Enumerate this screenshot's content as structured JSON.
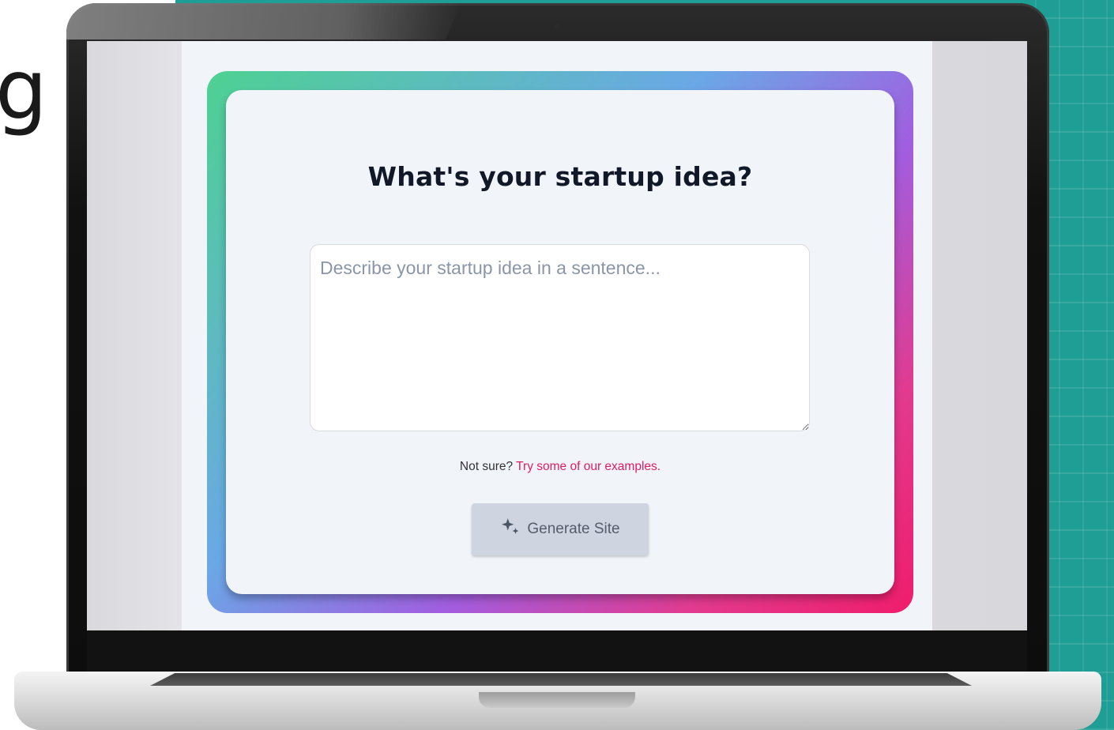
{
  "background": {
    "partial_glyph": "g",
    "accent_color": "#1f9e96"
  },
  "app": {
    "title": "What's your startup idea?",
    "idea_input": {
      "placeholder": "Describe your startup idea in a sentence...",
      "value": ""
    },
    "hint": {
      "prefix": "Not sure?",
      "link_label": "Try some of our examples."
    },
    "generate_button": {
      "label": "Generate Site",
      "icon": "sparkles-icon",
      "state": "disabled"
    },
    "colors": {
      "frame_gradient": [
        "#4ed192",
        "#6aa8e6",
        "#a15ee0",
        "#f01c6b"
      ],
      "link": "#e11d62",
      "title": "#111827",
      "button_bg": "#ced5e0"
    }
  }
}
